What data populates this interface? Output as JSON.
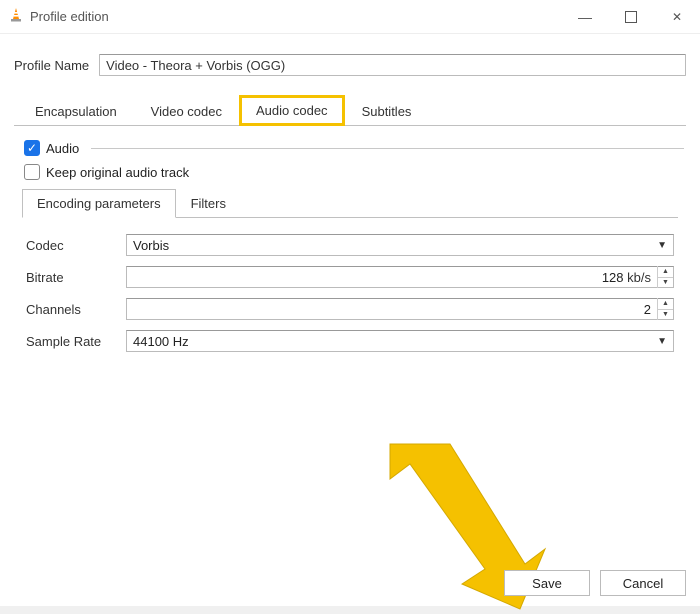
{
  "window": {
    "title": "Profile edition"
  },
  "profile": {
    "label": "Profile Name",
    "value": "Video - Theora + Vorbis (OGG)"
  },
  "tabs": {
    "encapsulation": "Encapsulation",
    "video": "Video codec",
    "audio": "Audio codec",
    "subtitles": "Subtitles"
  },
  "audio": {
    "checkbox_label": "Audio",
    "keep_original": "Keep original audio track",
    "subtabs": {
      "encoding": "Encoding parameters",
      "filters": "Filters"
    },
    "codec_label": "Codec",
    "codec_value": "Vorbis",
    "bitrate_label": "Bitrate",
    "bitrate_value": "128",
    "bitrate_unit": "kb/s",
    "channels_label": "Channels",
    "channels_value": "2",
    "samplerate_label": "Sample Rate",
    "samplerate_value": "44100 Hz"
  },
  "buttons": {
    "save": "Save",
    "cancel": "Cancel"
  }
}
